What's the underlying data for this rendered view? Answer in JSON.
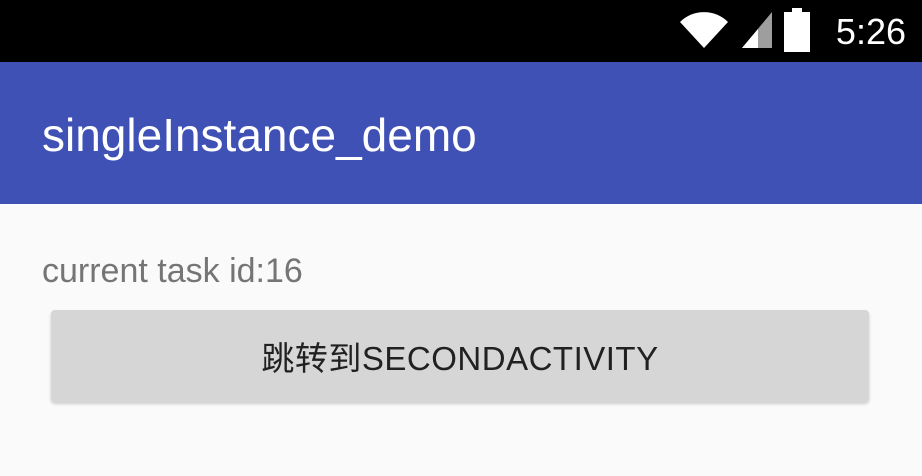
{
  "status_bar": {
    "time": "5:26",
    "icons": [
      "wifi-icon",
      "cell-signal-icon",
      "battery-icon"
    ]
  },
  "app_bar": {
    "title": "singleInstance_demo"
  },
  "main": {
    "task_label": "current task id:16",
    "jump_button_label": "跳转到SECONDACTIVITY"
  },
  "colors": {
    "primary": "#3f51b5",
    "status_bar": "#000000",
    "background": "#fafafa",
    "button": "#d6d6d6",
    "secondary_text": "#757575"
  }
}
